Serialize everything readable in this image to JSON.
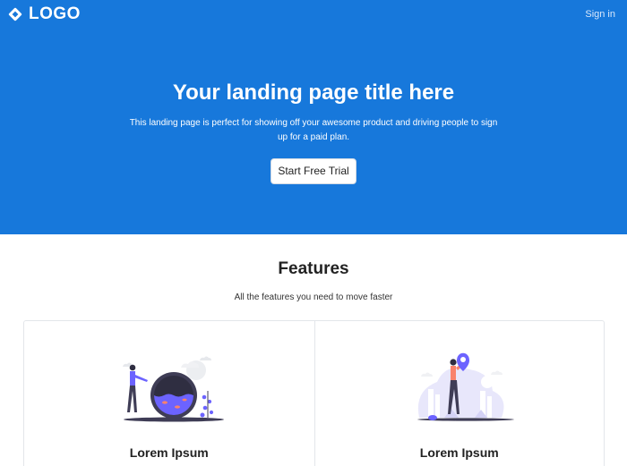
{
  "header": {
    "logo_text": "LOGO",
    "logo_icon": "diamond-logo-icon",
    "signin_label": "Sign in"
  },
  "hero": {
    "title": "Your landing page title here",
    "subtitle": "This landing page is perfect for showing off your awesome product and driving people to sign up for a paid plan.",
    "cta_label": "Start Free Trial"
  },
  "features": {
    "title": "Features",
    "subtitle": "All the features you need to move faster",
    "cards": [
      {
        "title": "Lorem Ipsum",
        "illustration": "person-with-fishbowl-illustration"
      },
      {
        "title": "Lorem Ipsum",
        "illustration": "person-with-location-pin-illustration"
      }
    ]
  },
  "colors": {
    "hero_background": "#1778db",
    "accent_purple": "#6c63ff",
    "accent_orange": "#f9826c"
  }
}
